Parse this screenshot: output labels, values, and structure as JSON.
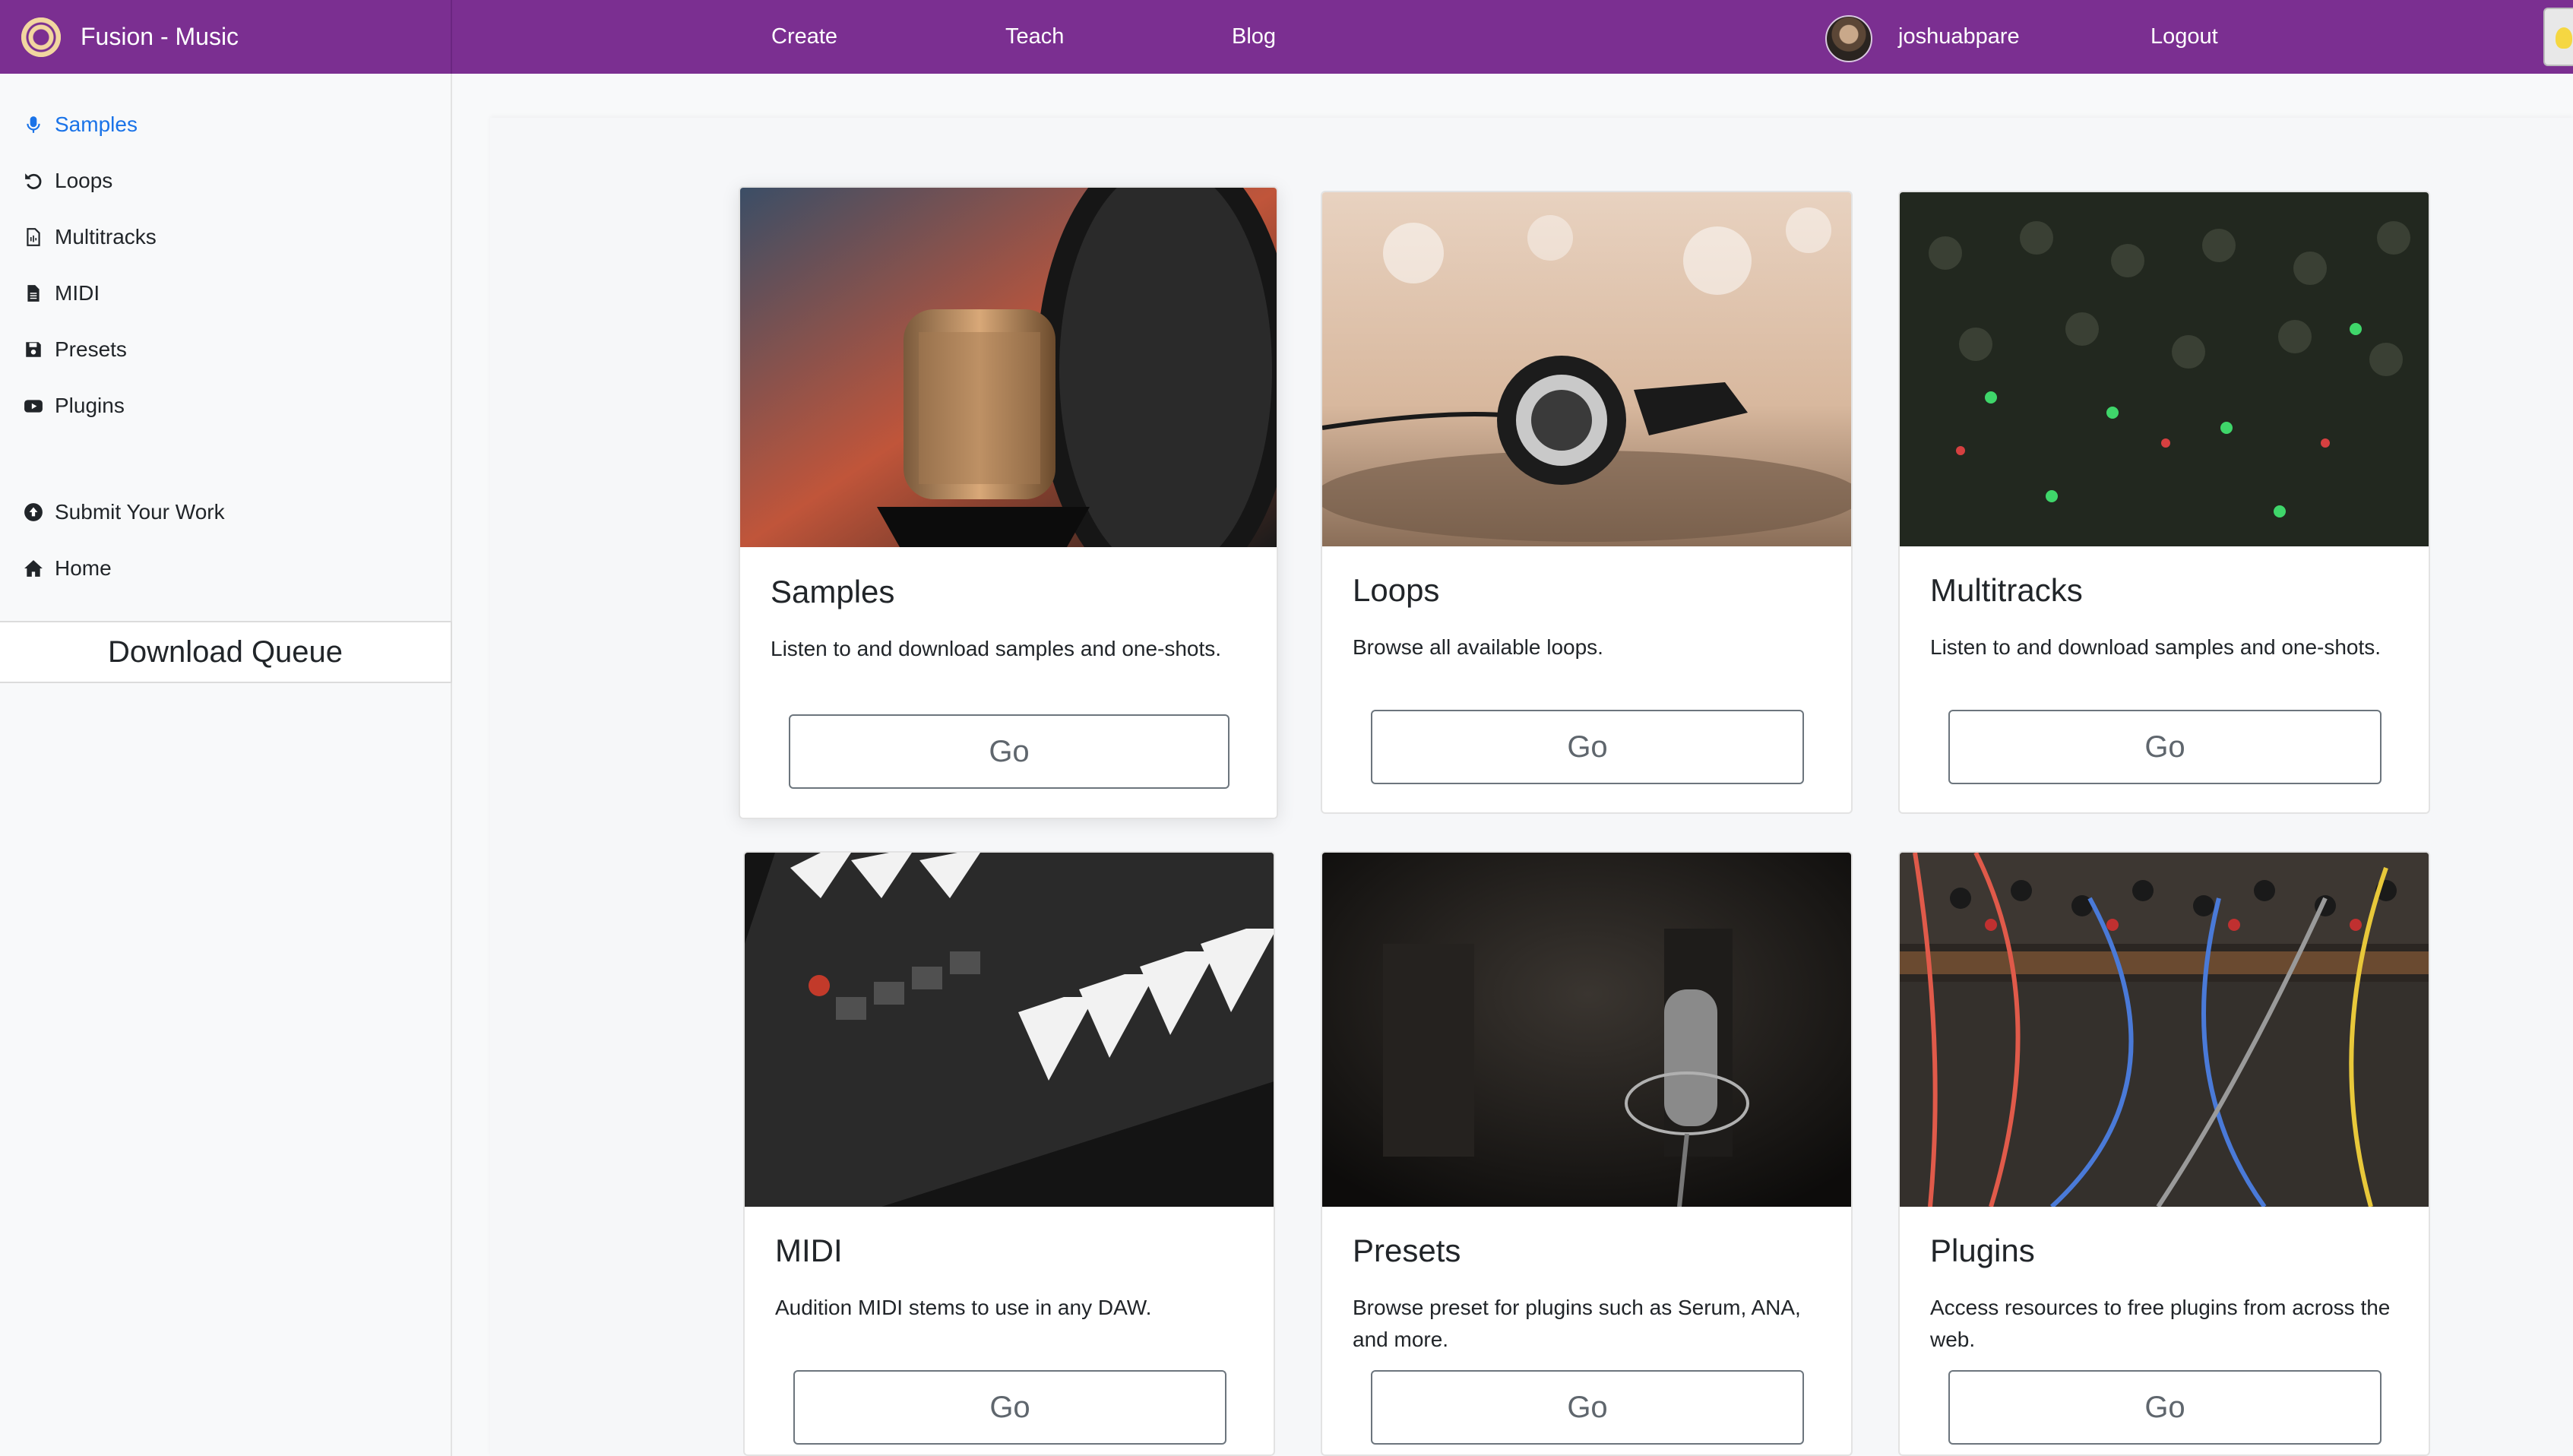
{
  "app": {
    "title": "Fusion - Music",
    "logo_icon": "sunflower-logo-icon"
  },
  "nav": {
    "links": [
      "Create",
      "Teach",
      "Blog"
    ],
    "username": "joshuabpare",
    "logout": "Logout"
  },
  "sidebar": {
    "items": [
      {
        "label": "Samples",
        "icon": "microphone-icon",
        "active": true
      },
      {
        "label": "Loops",
        "icon": "undo-icon",
        "active": false
      },
      {
        "label": "Multitracks",
        "icon": "file-audio-icon",
        "active": false
      },
      {
        "label": "MIDI",
        "icon": "file-icon",
        "active": false
      },
      {
        "label": "Presets",
        "icon": "save-icon",
        "active": false
      },
      {
        "label": "Plugins",
        "icon": "youtube-icon",
        "active": false
      }
    ],
    "extra": [
      {
        "label": "Submit Your Work",
        "icon": "upload-circle-icon"
      },
      {
        "label": "Home",
        "icon": "home-icon"
      }
    ],
    "download_queue": "Download Queue"
  },
  "cards": [
    {
      "title": "Samples",
      "description": "Listen to and download samples and one-shots.",
      "button": "Go",
      "image": "studio-microphone-photo"
    },
    {
      "title": "Loops",
      "description": "Browse all available loops.",
      "button": "Go",
      "image": "headphones-photo"
    },
    {
      "title": "Multitracks",
      "description": "Listen to and download samples and one-shots.",
      "button": "Go",
      "image": "mixing-console-photo"
    },
    {
      "title": "MIDI",
      "description": "Audition MIDI stems to use in any DAW.",
      "button": "Go",
      "image": "midi-keyboard-photo"
    },
    {
      "title": "Presets",
      "description": "Browse preset for plugins such as Serum, ANA, and more.",
      "button": "Go",
      "image": "condenser-mic-photo"
    },
    {
      "title": "Plugins",
      "description": "Access resources to free plugins from across the web.",
      "button": "Go",
      "image": "modular-synth-photo"
    }
  ],
  "colors": {
    "navbar": "#7b2f91",
    "active_link": "#1a73e8"
  }
}
